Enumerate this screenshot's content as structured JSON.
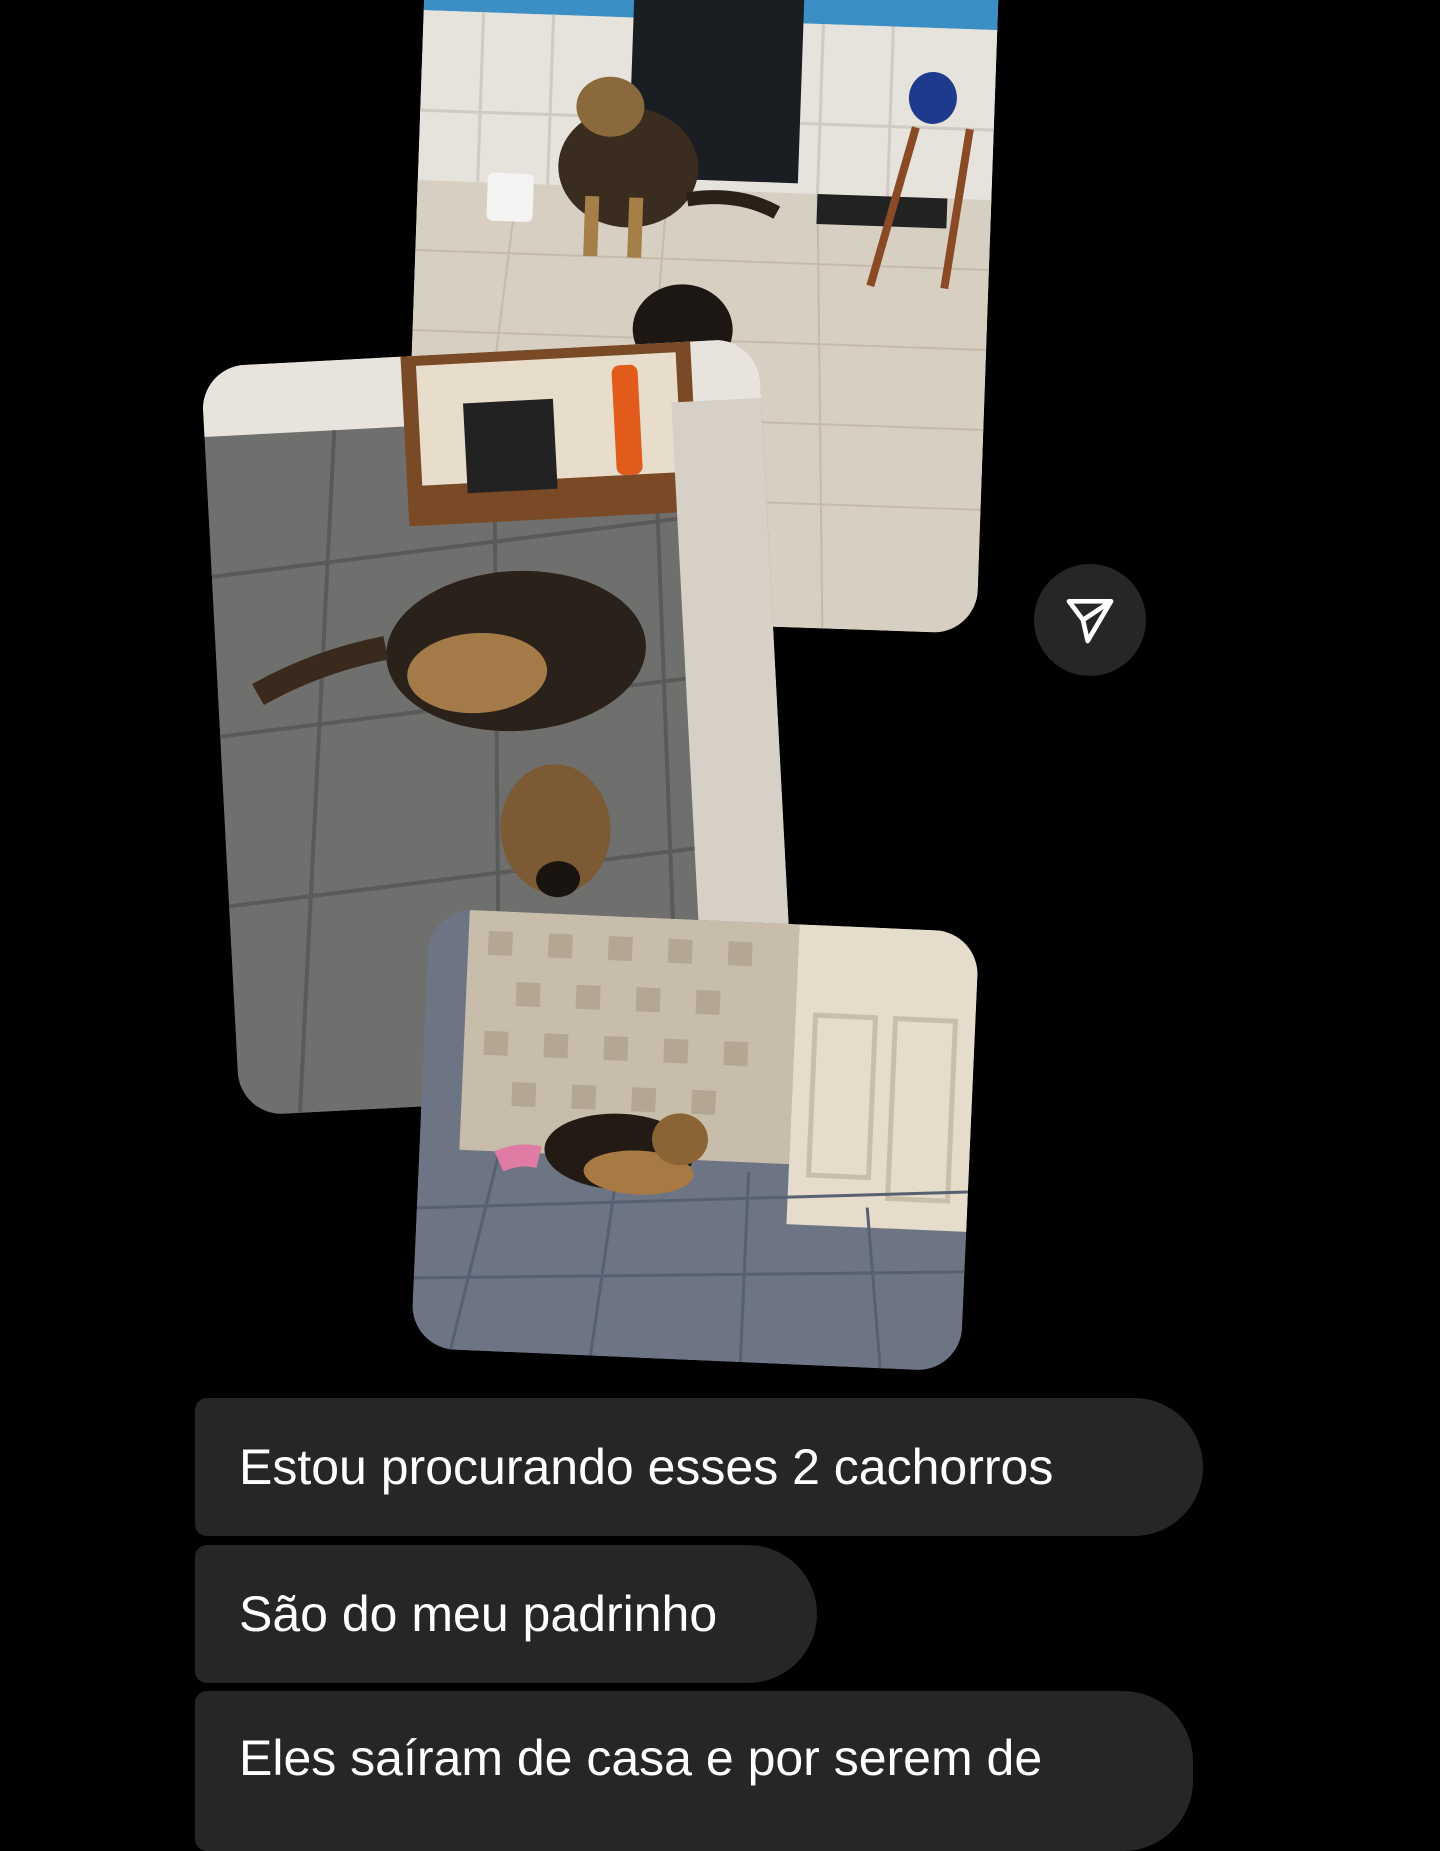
{
  "thread": {
    "images": [
      {
        "name": "dog-photo-1"
      },
      {
        "name": "dog-photo-2"
      },
      {
        "name": "dog-photo-3"
      }
    ],
    "share_icon": "paper-plane-icon",
    "messages": [
      {
        "text": "Estou procurando esses 2 cachorros"
      },
      {
        "text": "São do meu padrinho"
      },
      {
        "text": "Eles saíram de casa e por serem de"
      }
    ]
  },
  "colors": {
    "background": "#000000",
    "bubble": "#262626",
    "text": "#ffffff"
  }
}
